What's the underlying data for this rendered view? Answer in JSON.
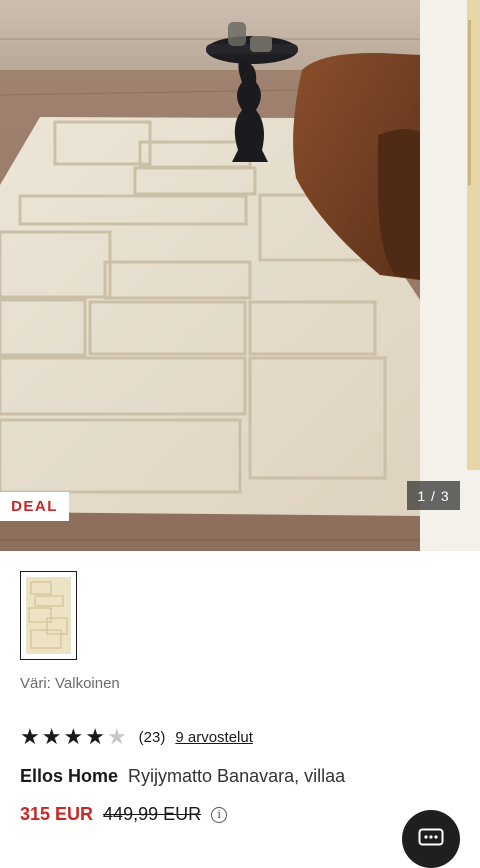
{
  "gallery": {
    "deal_badge": "DEAL",
    "counter": "1 / 3",
    "main_image_alt": "Beige shag rug with raised geometric pattern under a black side table and brown armchair"
  },
  "product": {
    "color_label": "Väri: Valkoinen",
    "rating": 4,
    "rating_max": 5,
    "rating_count": "(23)",
    "reviews_link": "9 arvostelut",
    "brand": "Ellos Home",
    "name": "Ryijymatto Banavara, villaa",
    "price_sale": "315 EUR",
    "price_original": "449,99 EUR"
  },
  "icons": {
    "info": "info-icon",
    "chat": "chat-icon",
    "star": "star-icon"
  },
  "colors": {
    "accent": "#c62828",
    "text": "#1a1a1a"
  }
}
